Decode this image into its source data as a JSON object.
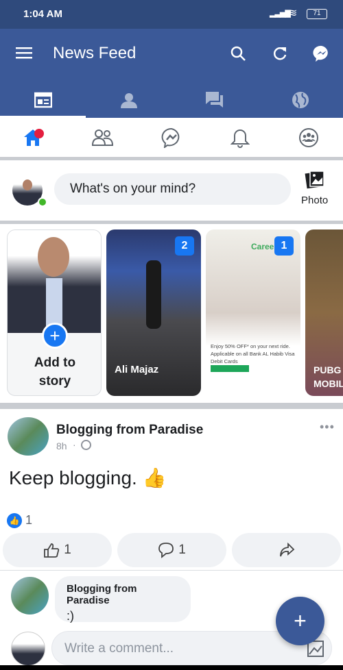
{
  "status": {
    "time": "1:04 AM",
    "battery": "71"
  },
  "header": {
    "title": "News Feed",
    "icons": [
      "menu-icon",
      "search-icon",
      "refresh-icon",
      "messenger-icon"
    ]
  },
  "top_tabs": [
    {
      "icon": "newsfeed-icon",
      "active": true
    },
    {
      "icon": "profile-icon"
    },
    {
      "icon": "chat-icon"
    },
    {
      "icon": "globe-icon"
    }
  ],
  "nav": [
    {
      "icon": "home-icon",
      "active": true,
      "badge": true
    },
    {
      "icon": "friends-icon"
    },
    {
      "icon": "messenger-icon"
    },
    {
      "icon": "bell-icon"
    },
    {
      "icon": "groups-icon"
    }
  ],
  "composer": {
    "placeholder": "What's on your mind?",
    "photo_label": "Photo"
  },
  "stories": [
    {
      "label": "Add to story"
    },
    {
      "name": "Ali Majaz",
      "count": "2"
    },
    {
      "name": "",
      "count": "1",
      "ad_text": "Enjoy 50% OFF* on your next ride. Applicable on all Bank AL Habib Visa Debit Cards",
      "brand": "Careers"
    },
    {
      "name": "PUBG MOBILE"
    }
  ],
  "post": {
    "author": "Blogging from Paradise",
    "time": "8h",
    "text": "Keep blogging. 👍",
    "reactions": "1",
    "like_count": "1",
    "comment_count": "1"
  },
  "comment": {
    "author": "Blogging from Paradise",
    "text": ":)",
    "input_placeholder": "Write a comment..."
  },
  "colors": {
    "brand": "#3b5998",
    "accent": "#1877f2",
    "status": "#2f4a7c"
  }
}
